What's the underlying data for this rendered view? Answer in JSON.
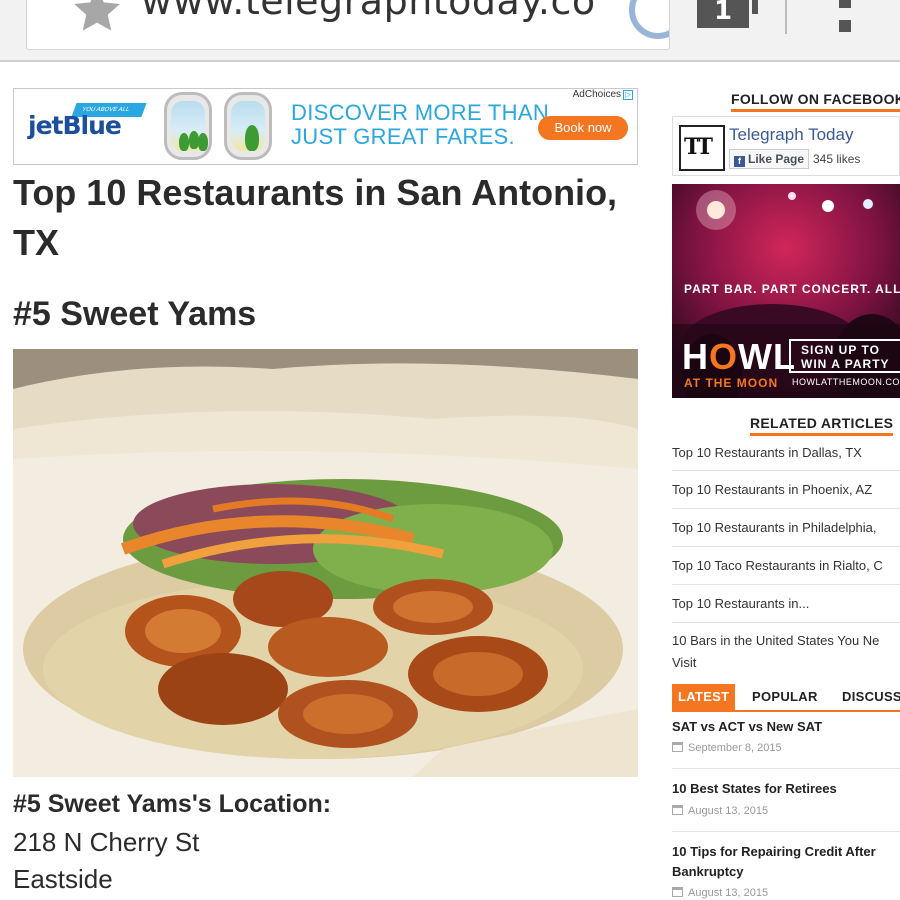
{
  "browser": {
    "url": "www.telegraphtoday.co",
    "tab_count": "1"
  },
  "ad": {
    "brand": "jetBlue",
    "tag": "YOU ABOVE ALL",
    "headline_line1": "DISCOVER MORE THAN",
    "headline_line2": "JUST GREAT FARES.",
    "cta": "Book now",
    "choices": "AdChoices"
  },
  "article": {
    "title": "Top 10 Restaurants in San Antonio, TX",
    "subhead": "#5 Sweet Yams",
    "location_heading": "#5 Sweet Yams's Location:",
    "address_line1": "218 N Cherry St",
    "address_line2": "Eastside"
  },
  "sidebar": {
    "facebook": {
      "heading": "FOLLOW ON FACEBOOK",
      "page_name": "Telegraph Today",
      "logo_text": "TT",
      "like_label": "Like Page",
      "likes": "345 likes"
    },
    "promo": {
      "tagline": "PART BAR. PART CONCERT. ALL FU",
      "logo": "HOWL",
      "logo_sub": "AT THE MOON",
      "cta_line1": "SIGN UP TO",
      "cta_line2": "WIN A PARTY",
      "url": "HOWLATTHEMOON.COM"
    },
    "related": {
      "heading": "RELATED ARTICLES",
      "items": [
        "Top 10 Restaurants in Dallas, TX",
        "Top 10 Restaurants in Phoenix, AZ",
        "Top 10 Restaurants in Philadelphia,",
        "Top 10 Taco Restaurants in Rialto, C",
        "Top 10 Restaurants in...",
        "10 Bars in the United States You Ne Visit"
      ]
    },
    "tabs": [
      "LATEST",
      "POPULAR",
      "DISCUSS"
    ],
    "latest": [
      {
        "title": "SAT vs ACT vs New SAT",
        "date": "September 8, 2015"
      },
      {
        "title": "10 Best States for Retirees",
        "date": "August 13, 2015"
      },
      {
        "title": "10 Tips for Repairing Credit After Bankruptcy",
        "date": "August 13, 2015"
      }
    ]
  },
  "colors": {
    "accent": "#f47621",
    "facebook_blue": "#3b5998",
    "jetblue_blue": "#2aa7e0"
  }
}
